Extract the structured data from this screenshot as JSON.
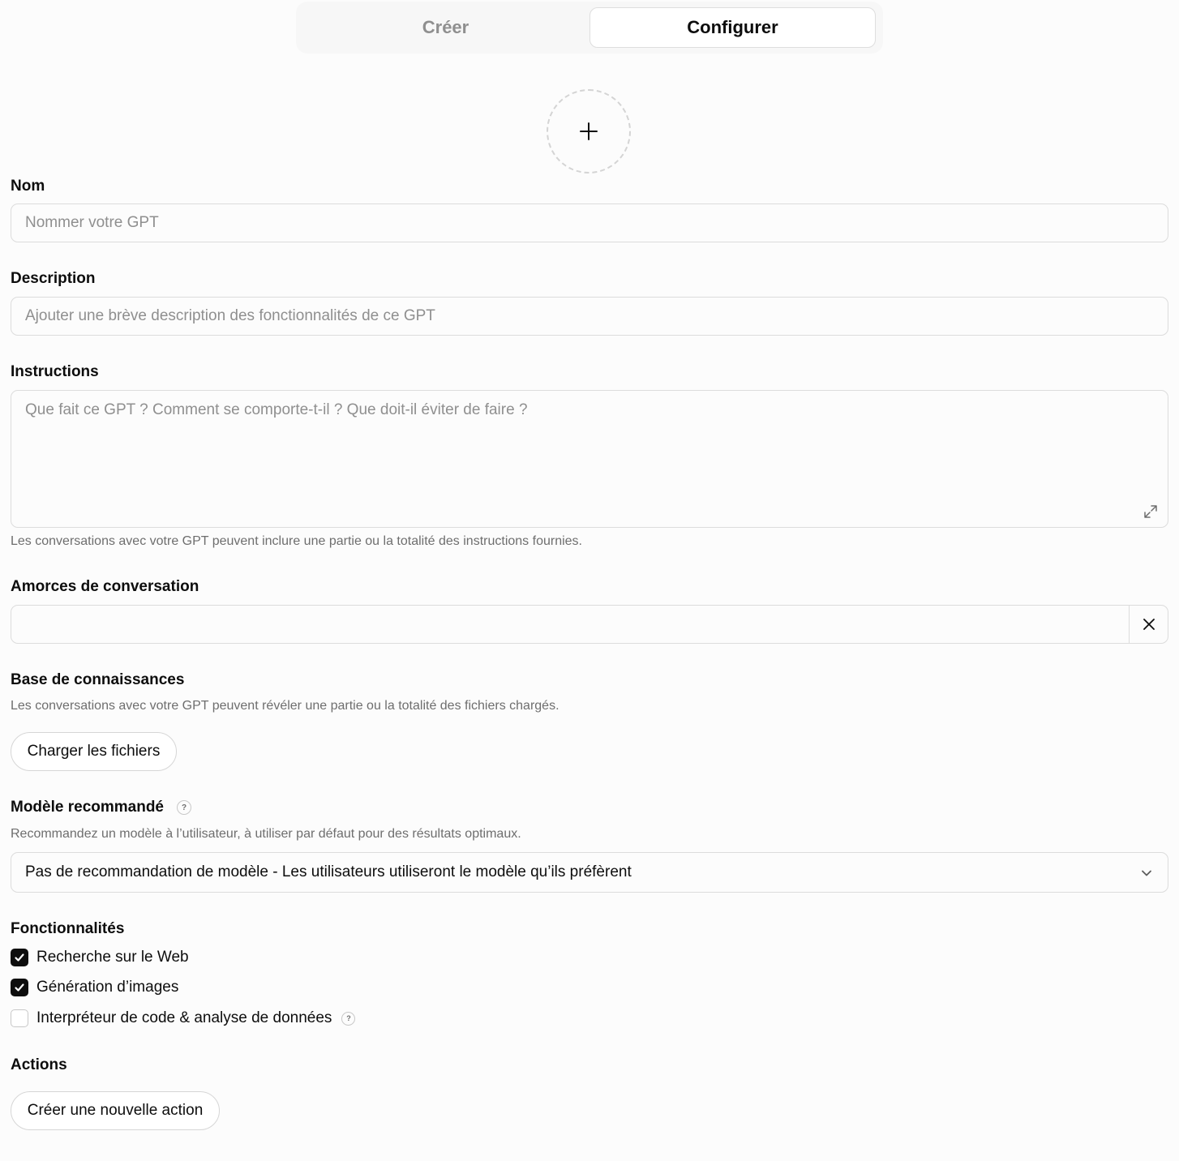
{
  "tabs": {
    "create": "Créer",
    "configure": "Configurer"
  },
  "avatar": {
    "icon": "plus-icon"
  },
  "name": {
    "label": "Nom",
    "placeholder": "Nommer votre GPT",
    "value": ""
  },
  "description": {
    "label": "Description",
    "placeholder": "Ajouter une brève description des fonctionnalités de ce GPT",
    "value": ""
  },
  "instructions": {
    "label": "Instructions",
    "placeholder": "Que fait ce GPT ? Comment se comporte-t-il ? Que doit-il éviter de faire ?",
    "value": "",
    "hint": "Les conversations avec votre GPT peuvent inclure une partie ou la totalité des instructions fournies."
  },
  "starters": {
    "label": "Amorces de conversation",
    "value": ""
  },
  "knowledge": {
    "label": "Base de connaissances",
    "hint": "Les conversations avec votre GPT peuvent révéler une partie ou la totalité des fichiers chargés.",
    "upload_label": "Charger les fichiers"
  },
  "model": {
    "label": "Modèle recommandé",
    "hint": "Recommandez un modèle à l’utilisateur, à utiliser par défaut pour des résultats optimaux.",
    "selected": "Pas de recommandation de modèle - Les utilisateurs utiliseront le modèle qu’ils préfèrent",
    "help_glyph": "?"
  },
  "capabilities": {
    "label": "Fonctionnalités",
    "items": [
      {
        "label": "Recherche sur le Web",
        "checked": true
      },
      {
        "label": "Génération d’images",
        "checked": true
      },
      {
        "label": "Interpréteur de code & analyse de données",
        "checked": false,
        "help_glyph": "?"
      }
    ]
  },
  "actions": {
    "label": "Actions",
    "create_label": "Créer une nouvelle action"
  },
  "colors": {
    "background": "#fcfcfc",
    "text": "#0d0d0d",
    "muted": "#8f8f8f",
    "border": "#dcdcdc",
    "checkbox_on": "#0d0d0d"
  }
}
